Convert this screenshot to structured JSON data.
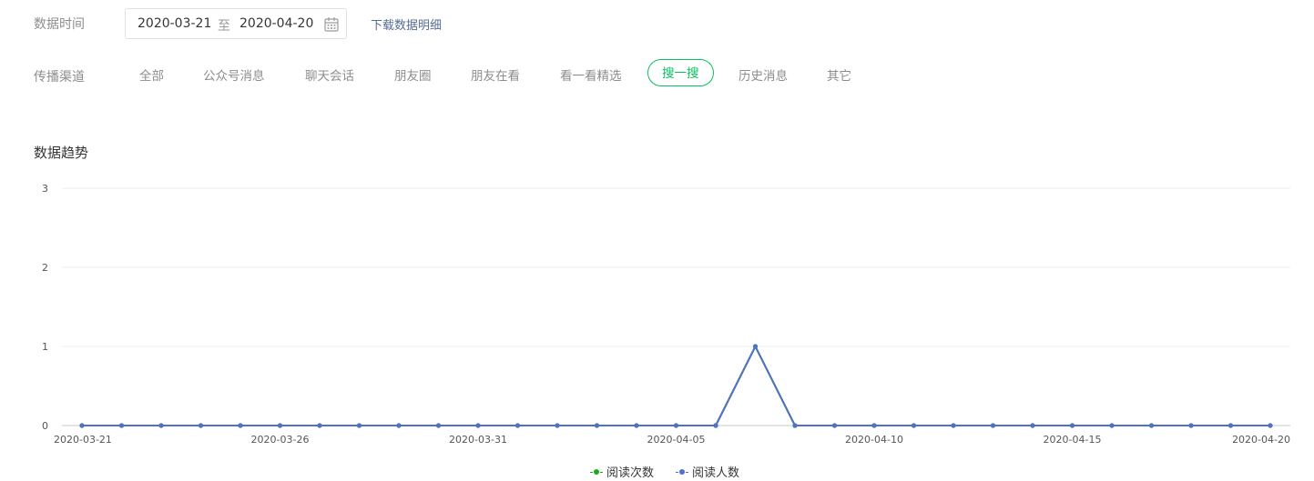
{
  "filters": {
    "date_label": "数据时间",
    "date_start": "2020-03-21",
    "date_separator": "至",
    "date_end": "2020-04-20",
    "calendar_icon": "calendar-icon",
    "download_label": "下载数据明细",
    "channel_label": "传播渠道",
    "channels": [
      "全部",
      "公众号消息",
      "聊天会话",
      "朋友圈",
      "朋友在看",
      "看一看精选",
      "搜一搜",
      "历史消息",
      "其它"
    ],
    "active_channel": "搜一搜"
  },
  "colors": {
    "accent": "#07c160",
    "link": "#576b95",
    "series_reads": "#1aad19",
    "series_readers": "#5470c6"
  },
  "section_title": "数据趋势",
  "chart_data": {
    "type": "line",
    "title": "",
    "xlabel": "",
    "ylabel": "",
    "x": [
      "2020-03-21",
      "2020-03-22",
      "2020-03-23",
      "2020-03-24",
      "2020-03-25",
      "2020-03-26",
      "2020-03-27",
      "2020-03-28",
      "2020-03-29",
      "2020-03-30",
      "2020-03-31",
      "2020-04-01",
      "2020-04-02",
      "2020-04-03",
      "2020-04-04",
      "2020-04-05",
      "2020-04-06",
      "2020-04-07",
      "2020-04-08",
      "2020-04-09",
      "2020-04-10",
      "2020-04-11",
      "2020-04-12",
      "2020-04-13",
      "2020-04-14",
      "2020-04-15",
      "2020-04-16",
      "2020-04-17",
      "2020-04-18",
      "2020-04-19",
      "2020-04-20"
    ],
    "x_tick_labels": [
      "2020-03-21",
      "2020-03-26",
      "2020-03-31",
      "2020-04-05",
      "2020-04-10",
      "2020-04-15",
      "2020-04-20"
    ],
    "ylim": [
      0,
      3
    ],
    "y_ticks": [
      0,
      1,
      2,
      3
    ],
    "grid": true,
    "legend_position": "bottom-center",
    "series": [
      {
        "name": "阅读次数",
        "values": [
          0,
          0,
          0,
          0,
          0,
          0,
          0,
          0,
          0,
          0,
          0,
          0,
          0,
          0,
          0,
          0,
          0,
          1,
          0,
          0,
          0,
          0,
          0,
          0,
          0,
          0,
          0,
          0,
          0,
          0,
          0
        ]
      },
      {
        "name": "阅读人数",
        "values": [
          0,
          0,
          0,
          0,
          0,
          0,
          0,
          0,
          0,
          0,
          0,
          0,
          0,
          0,
          0,
          0,
          0,
          1,
          0,
          0,
          0,
          0,
          0,
          0,
          0,
          0,
          0,
          0,
          0,
          0,
          0
        ]
      }
    ]
  }
}
